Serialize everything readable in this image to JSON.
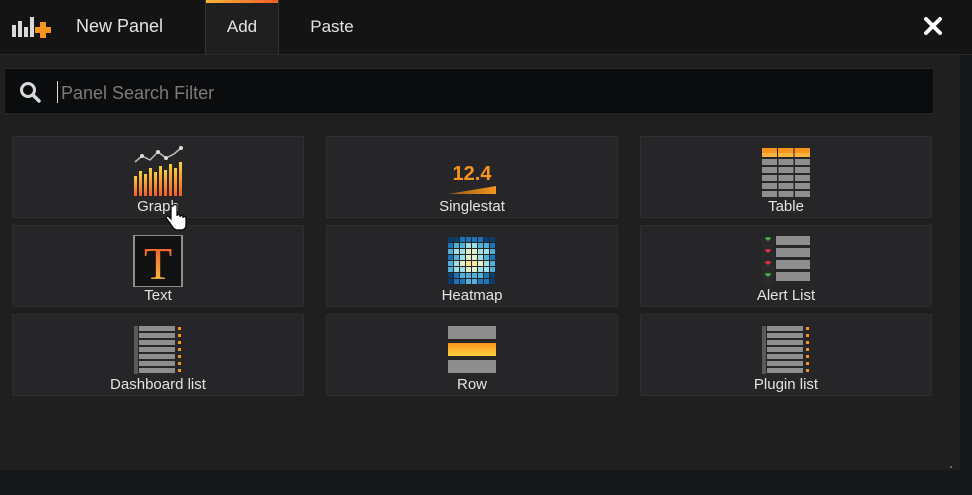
{
  "header": {
    "title": "New Panel",
    "tabs": [
      {
        "label": "Add",
        "active": true
      },
      {
        "label": "Paste",
        "active": false
      }
    ],
    "close_icon": "close-icon"
  },
  "search": {
    "placeholder": "Panel Search Filter",
    "value": ""
  },
  "panels": [
    {
      "label": "Graph",
      "icon": "graph-icon"
    },
    {
      "label": "Singlestat",
      "icon": "singlestat-icon",
      "icon_text": "12.4"
    },
    {
      "label": "Table",
      "icon": "table-icon"
    },
    {
      "label": "Text",
      "icon": "text-icon",
      "icon_text": "T"
    },
    {
      "label": "Heatmap",
      "icon": "heatmap-icon"
    },
    {
      "label": "Alert List",
      "icon": "alert-list-icon"
    },
    {
      "label": "Dashboard list",
      "icon": "dashboard-list-icon"
    },
    {
      "label": "Row",
      "icon": "row-icon"
    },
    {
      "label": "Plugin list",
      "icon": "plugin-list-icon"
    }
  ],
  "colors": {
    "accent_orange": "#f7941d",
    "accent_yellow": "#fbb43c",
    "background": "#1f1f20",
    "card": "#262628"
  }
}
